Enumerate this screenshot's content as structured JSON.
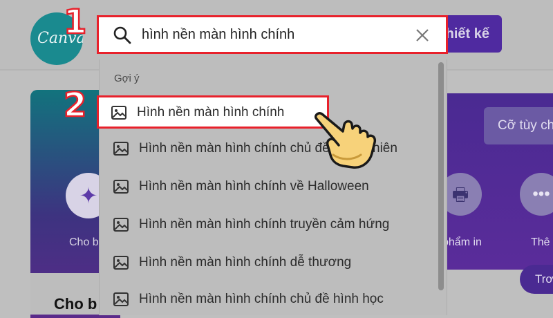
{
  "app": {
    "logo_text": "Canva",
    "design_button_label": "hiết kế",
    "custom_size_button_label": "Cỡ tùy ch",
    "search": {
      "value": "hình nền màn hình chính",
      "search_icon": "search-icon",
      "clear_icon": "close-icon"
    },
    "background_cards": {
      "left_caption": "Cho b",
      "left_bold_heading": "Cho b",
      "right_caption_print": "phẩm in",
      "right_caption_more": "Thê",
      "right_bottom_button": "Trơ"
    }
  },
  "suggestions": {
    "heading": "Gợi ý",
    "items": [
      {
        "label": "Hình nền màn hình chính",
        "icon": "image-icon"
      },
      {
        "label": "Hình nền màn hình chính chủ đề thiên nhiên",
        "icon": "image-icon"
      },
      {
        "label": "Hình nền màn hình chính về Halloween",
        "icon": "image-icon"
      },
      {
        "label": "Hình nền màn hình chính truyền cảm hứng",
        "icon": "image-icon"
      },
      {
        "label": "Hình nền màn hình chính dễ thương",
        "icon": "image-icon"
      },
      {
        "label": "Hình nền màn hình chính chủ đề hình học",
        "icon": "image-icon"
      }
    ]
  },
  "annotations": {
    "step1": "1",
    "step2": "2"
  },
  "colors": {
    "highlight_red": "#e8212b",
    "brand_purple": "#4f2aa0",
    "logo_teal": "#1a8a8f"
  }
}
